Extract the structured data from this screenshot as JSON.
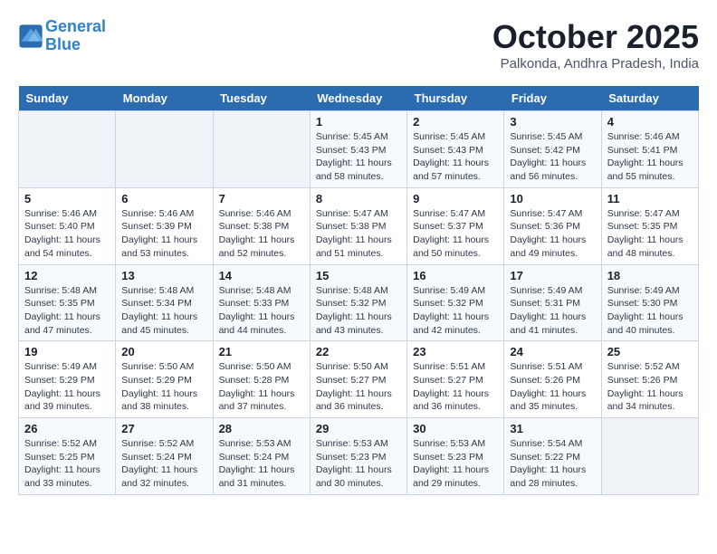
{
  "header": {
    "logo_line1": "General",
    "logo_line2": "Blue",
    "month": "October 2025",
    "location": "Palkonda, Andhra Pradesh, India"
  },
  "weekdays": [
    "Sunday",
    "Monday",
    "Tuesday",
    "Wednesday",
    "Thursday",
    "Friday",
    "Saturday"
  ],
  "weeks": [
    [
      {
        "day": "",
        "info": ""
      },
      {
        "day": "",
        "info": ""
      },
      {
        "day": "",
        "info": ""
      },
      {
        "day": "1",
        "info": "Sunrise: 5:45 AM\nSunset: 5:43 PM\nDaylight: 11 hours\nand 58 minutes."
      },
      {
        "day": "2",
        "info": "Sunrise: 5:45 AM\nSunset: 5:43 PM\nDaylight: 11 hours\nand 57 minutes."
      },
      {
        "day": "3",
        "info": "Sunrise: 5:45 AM\nSunset: 5:42 PM\nDaylight: 11 hours\nand 56 minutes."
      },
      {
        "day": "4",
        "info": "Sunrise: 5:46 AM\nSunset: 5:41 PM\nDaylight: 11 hours\nand 55 minutes."
      }
    ],
    [
      {
        "day": "5",
        "info": "Sunrise: 5:46 AM\nSunset: 5:40 PM\nDaylight: 11 hours\nand 54 minutes."
      },
      {
        "day": "6",
        "info": "Sunrise: 5:46 AM\nSunset: 5:39 PM\nDaylight: 11 hours\nand 53 minutes."
      },
      {
        "day": "7",
        "info": "Sunrise: 5:46 AM\nSunset: 5:38 PM\nDaylight: 11 hours\nand 52 minutes."
      },
      {
        "day": "8",
        "info": "Sunrise: 5:47 AM\nSunset: 5:38 PM\nDaylight: 11 hours\nand 51 minutes."
      },
      {
        "day": "9",
        "info": "Sunrise: 5:47 AM\nSunset: 5:37 PM\nDaylight: 11 hours\nand 50 minutes."
      },
      {
        "day": "10",
        "info": "Sunrise: 5:47 AM\nSunset: 5:36 PM\nDaylight: 11 hours\nand 49 minutes."
      },
      {
        "day": "11",
        "info": "Sunrise: 5:47 AM\nSunset: 5:35 PM\nDaylight: 11 hours\nand 48 minutes."
      }
    ],
    [
      {
        "day": "12",
        "info": "Sunrise: 5:48 AM\nSunset: 5:35 PM\nDaylight: 11 hours\nand 47 minutes."
      },
      {
        "day": "13",
        "info": "Sunrise: 5:48 AM\nSunset: 5:34 PM\nDaylight: 11 hours\nand 45 minutes."
      },
      {
        "day": "14",
        "info": "Sunrise: 5:48 AM\nSunset: 5:33 PM\nDaylight: 11 hours\nand 44 minutes."
      },
      {
        "day": "15",
        "info": "Sunrise: 5:48 AM\nSunset: 5:32 PM\nDaylight: 11 hours\nand 43 minutes."
      },
      {
        "day": "16",
        "info": "Sunrise: 5:49 AM\nSunset: 5:32 PM\nDaylight: 11 hours\nand 42 minutes."
      },
      {
        "day": "17",
        "info": "Sunrise: 5:49 AM\nSunset: 5:31 PM\nDaylight: 11 hours\nand 41 minutes."
      },
      {
        "day": "18",
        "info": "Sunrise: 5:49 AM\nSunset: 5:30 PM\nDaylight: 11 hours\nand 40 minutes."
      }
    ],
    [
      {
        "day": "19",
        "info": "Sunrise: 5:49 AM\nSunset: 5:29 PM\nDaylight: 11 hours\nand 39 minutes."
      },
      {
        "day": "20",
        "info": "Sunrise: 5:50 AM\nSunset: 5:29 PM\nDaylight: 11 hours\nand 38 minutes."
      },
      {
        "day": "21",
        "info": "Sunrise: 5:50 AM\nSunset: 5:28 PM\nDaylight: 11 hours\nand 37 minutes."
      },
      {
        "day": "22",
        "info": "Sunrise: 5:50 AM\nSunset: 5:27 PM\nDaylight: 11 hours\nand 36 minutes."
      },
      {
        "day": "23",
        "info": "Sunrise: 5:51 AM\nSunset: 5:27 PM\nDaylight: 11 hours\nand 36 minutes."
      },
      {
        "day": "24",
        "info": "Sunrise: 5:51 AM\nSunset: 5:26 PM\nDaylight: 11 hours\nand 35 minutes."
      },
      {
        "day": "25",
        "info": "Sunrise: 5:52 AM\nSunset: 5:26 PM\nDaylight: 11 hours\nand 34 minutes."
      }
    ],
    [
      {
        "day": "26",
        "info": "Sunrise: 5:52 AM\nSunset: 5:25 PM\nDaylight: 11 hours\nand 33 minutes."
      },
      {
        "day": "27",
        "info": "Sunrise: 5:52 AM\nSunset: 5:24 PM\nDaylight: 11 hours\nand 32 minutes."
      },
      {
        "day": "28",
        "info": "Sunrise: 5:53 AM\nSunset: 5:24 PM\nDaylight: 11 hours\nand 31 minutes."
      },
      {
        "day": "29",
        "info": "Sunrise: 5:53 AM\nSunset: 5:23 PM\nDaylight: 11 hours\nand 30 minutes."
      },
      {
        "day": "30",
        "info": "Sunrise: 5:53 AM\nSunset: 5:23 PM\nDaylight: 11 hours\nand 29 minutes."
      },
      {
        "day": "31",
        "info": "Sunrise: 5:54 AM\nSunset: 5:22 PM\nDaylight: 11 hours\nand 28 minutes."
      },
      {
        "day": "",
        "info": ""
      }
    ]
  ]
}
